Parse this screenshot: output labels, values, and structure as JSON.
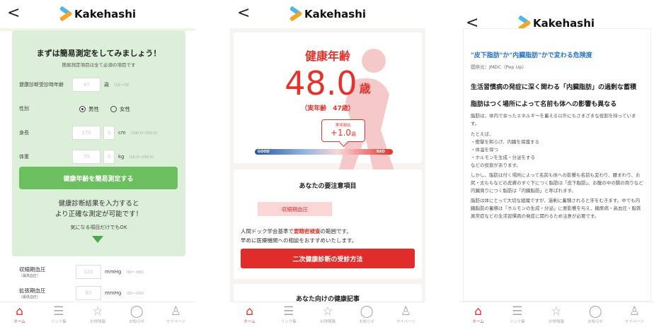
{
  "brand": "Kakehashi",
  "nav": [
    {
      "label": "ホーム",
      "icon": "home-icon",
      "glyph": "⌂"
    },
    {
      "label": "リンク集",
      "icon": "list-icon",
      "glyph": "☰"
    },
    {
      "label": "お得情報",
      "icon": "star-icon",
      "glyph": "☆"
    },
    {
      "label": "お知らせ",
      "icon": "chat-icon",
      "glyph": "◯"
    },
    {
      "label": "マイページ",
      "icon": "person-icon",
      "glyph": "♙"
    }
  ],
  "screen1": {
    "title": "まずは簡易測定をしてみましょう！",
    "subtitle": "簡易測定項目は全て必須の項目です",
    "age_label": "健康診断受診時年齢",
    "age_placeholder": "47",
    "age_unit": "歳",
    "age_hint": "（18〜79）",
    "sex_label": "性別",
    "male": "男性",
    "female": "女性",
    "height_label": "身長",
    "height_placeholder": "170",
    "height_dec_placeholder": "0",
    "height_unit": "cm",
    "height_hint": "（100.0〜250.0）",
    "weight_label": "体重",
    "weight_placeholder": "70",
    "weight_dec_placeholder": "0",
    "weight_unit": "kg",
    "weight_hint": "（20.0〜250.0）",
    "button": "健康年齢を簡易測定する",
    "msg1": "健康診断結果を入力すると",
    "msg2": "より正確な測定が可能です！",
    "msg3": "気になる項目だけでもOK",
    "sbp_label": "収縮期血圧",
    "sbp_sub": "（最高血圧）",
    "sbp_placeholder": "120",
    "sbp_unit": "mmHg",
    "sbp_hint": "（60〜300）",
    "dbp_label": "拡張期血圧",
    "dbp_sub": "（最低血圧）",
    "dbp_placeholder": "80",
    "dbp_unit": "mmHg",
    "dbp_hint": "（30〜150）"
  },
  "screen2": {
    "title": "健康年齢",
    "age": "48.0",
    "age_unit": "歳",
    "real_age_text": "（実年齢　47歳）",
    "bubble_label": "実年齢比",
    "bubble_value": "+1.0",
    "bubble_unit": "歳",
    "good": "GOOD",
    "bad": "BAD",
    "section_title": "あなたの要注意項目",
    "tag": "収縮期血圧",
    "advice_pre": "人間ドック学会基準で",
    "advice_em": "要精密検査",
    "advice_post": "の範囲です。",
    "advice2": "早めに医療機関への相談をおすすめいたします。",
    "button": "二次健康診断の受診方法",
    "next_title": "あなた向けの健康記事"
  },
  "screen3": {
    "title": "\"皮下脂肪\"か\"内臓脂肪\"かで変わる危険度",
    "source": "提供元：JMDC（Pep Up）",
    "h1": "生活習慣病の発症に深く関わる「内臓脂肪」の過剰な蓄積",
    "h2": "脂肪はつく場所によって名前も体への影響も異なる",
    "p1": "脂肪は、体内で余ったエネルギーを蓄える以外にもさまざまな役割を持っています。",
    "p2": "たとえば、",
    "li1": "・衝撃を和らげ、内臓を保護する",
    "li2": "・体温を保つ",
    "li3": "・ホルモンを生成・分泌をする",
    "p3": "などの役割があります。",
    "p4": "しかし、脂肪は付く場所によって名前も体への影響も名前も変わり、腰まわり、お尻・太ももなどの皮膚のすぐ下につく脂肪は「皮下脂肪」、お腹の中の腸の周りなど内臓周りにつく脂肪は「内臓脂肪」と呼ばれます。",
    "p5": "脂肪は体にとって大切な組織ですが、過剰に蓄積されると牙をむきます。中でも内臓脂肪の蓄積は「ホルモンの生成・分泌」に悪影響を与え、糖尿病・高血圧・脂質異常症などの生活習慣病の発症に関わるため注意が必要です。"
  }
}
